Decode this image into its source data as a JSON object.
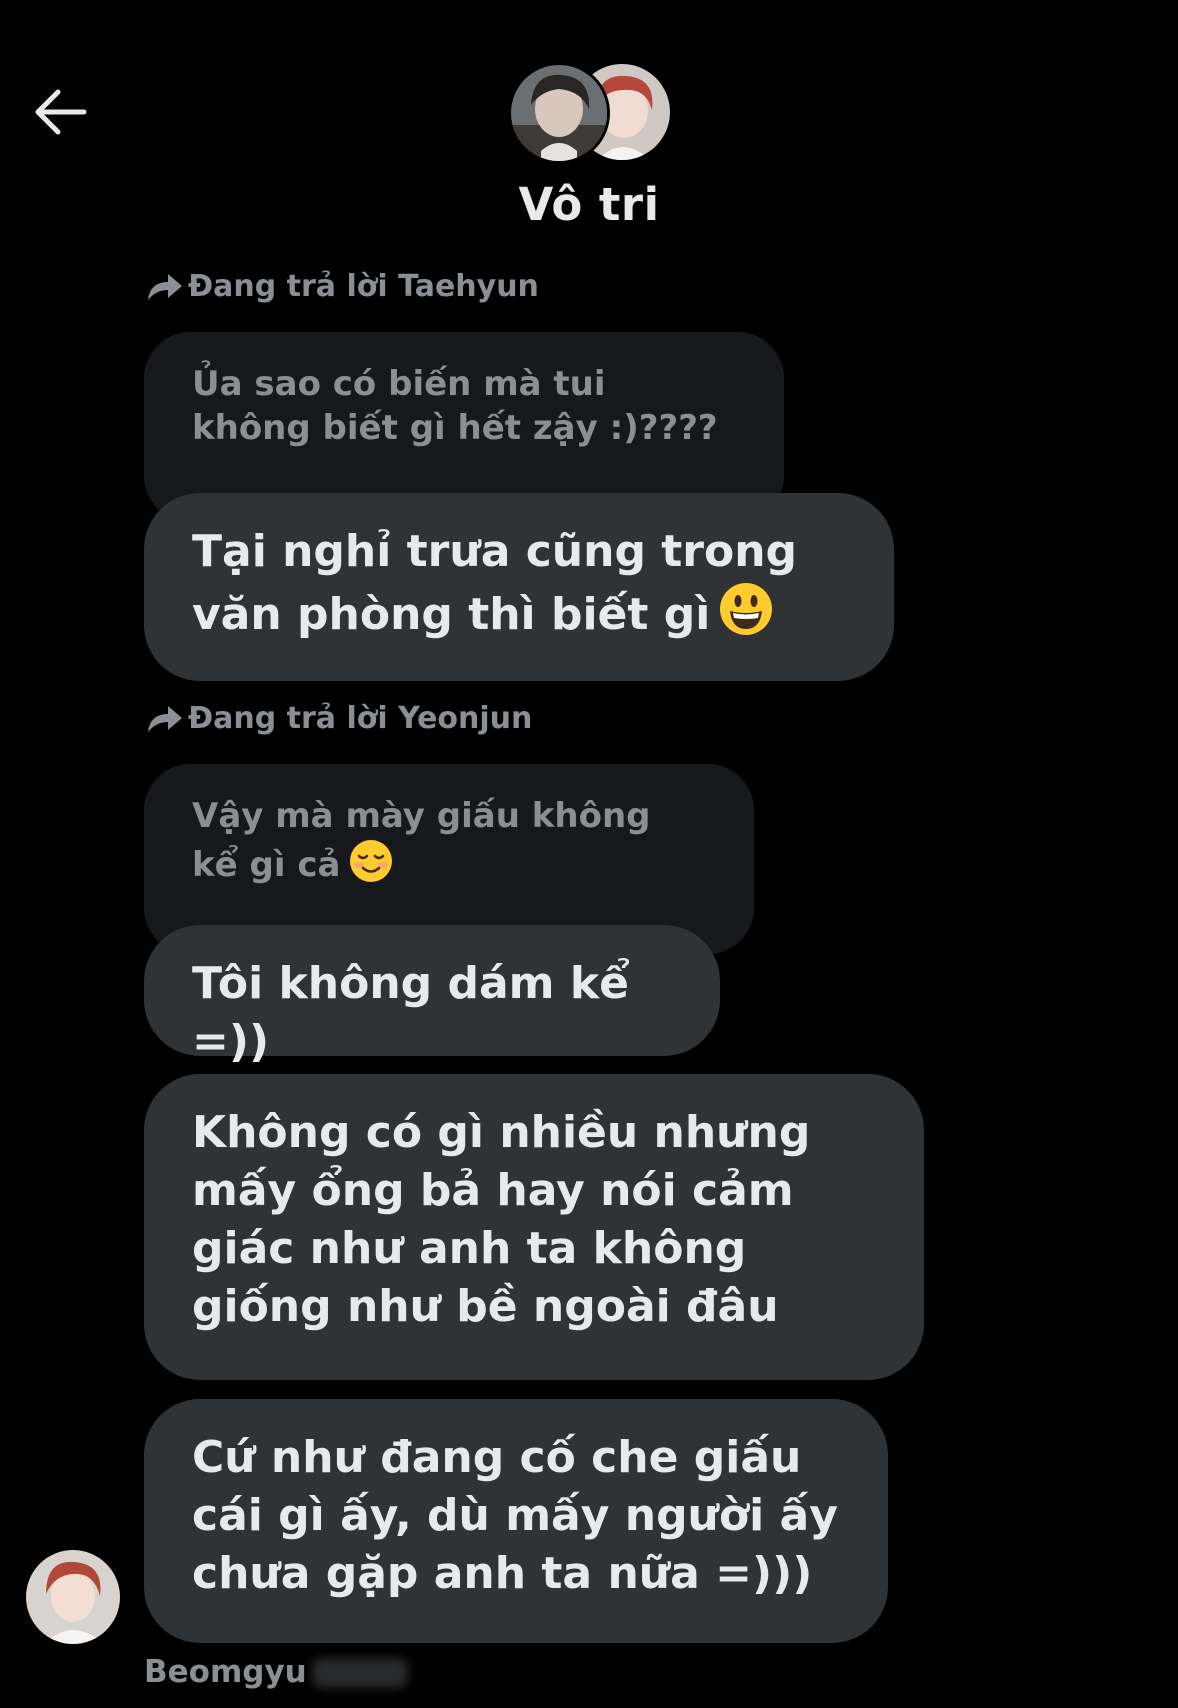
{
  "header": {
    "back_icon": "arrow-left-icon",
    "title": "Vô tri",
    "avatars": [
      "member-avatar-1",
      "member-avatar-2"
    ]
  },
  "colors": {
    "background": "#000000",
    "bubble": "#2f3336",
    "quoted_bubble": "#16181c",
    "primary_text": "#e7e9ea",
    "secondary_text": "#8b8f94"
  },
  "messages": [
    {
      "reply_label": "Đang trả lời Taehyun",
      "quoted_text": "Ủa sao có biến mà tui không biết gì hết zậy :)????",
      "text": "Tại nghỉ trưa cũng trong văn phòng thì biết gì",
      "emoji": "grinning-face-emoji"
    },
    {
      "reply_label": "Đang trả lời Yeonjun",
      "quoted_text": "Vậy mà mày giấu không kể gì cả",
      "quoted_emoji": "smiling-face-emoji",
      "text": "Tôi không dám kể =))"
    },
    {
      "text": "Không có gì nhiều nhưng mấy ổng bả hay nói cảm giác như anh ta không giống như bề ngoài đâu"
    },
    {
      "text": "Cứ như đang cố che giấu cái gì ấy, dù mấy người ấy chưa gặp anh ta nữa =)))"
    }
  ],
  "sender": {
    "name": "Beomgyu",
    "avatar": "sender-avatar"
  }
}
